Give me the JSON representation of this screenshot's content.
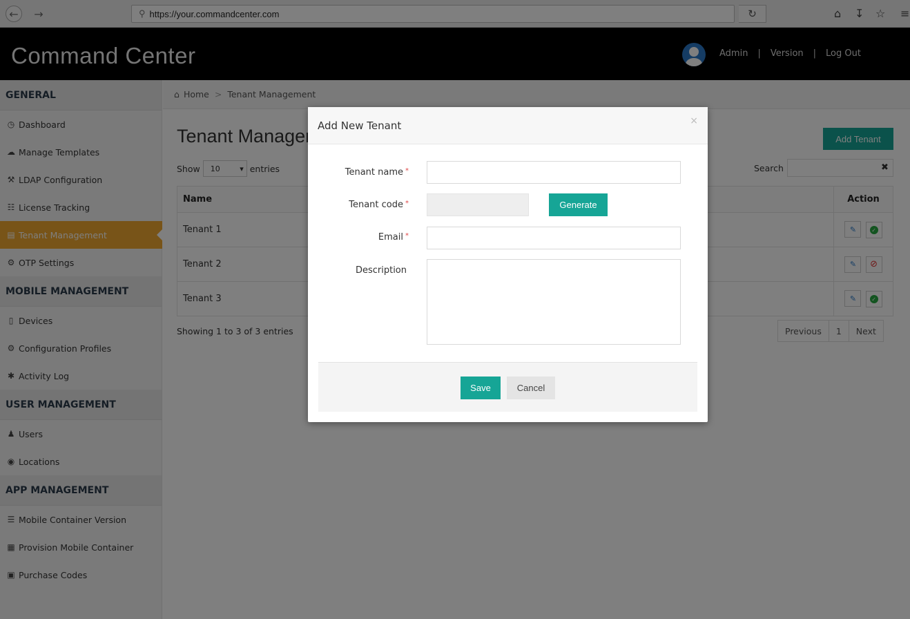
{
  "browser": {
    "url": "https://your.commandcenter.com",
    "back_icon": "back-arrow-icon",
    "forward_icon": "forward-arrow-icon"
  },
  "header": {
    "title": "Command Center",
    "user": "Admin",
    "sep": "|",
    "version": "Version",
    "logout": "Log Out"
  },
  "sidebar": {
    "general": {
      "heading": "GENERAL",
      "items": [
        {
          "label": "Dashboard",
          "icon": "dashboard-icon"
        },
        {
          "label": "Manage Templates",
          "icon": "cloud-icon"
        },
        {
          "label": "LDAP Configuration",
          "icon": "wrench-icon"
        },
        {
          "label": "License Tracking",
          "icon": "barcode-icon"
        },
        {
          "label": "Tenant Management",
          "icon": "list-icon"
        },
        {
          "label": "OTP Settings",
          "icon": "gear-icon"
        }
      ]
    },
    "mobile": {
      "heading": "MOBILE MANAGEMENT",
      "items": [
        {
          "label": "Devices",
          "icon": "mobile-icon"
        },
        {
          "label": "Configuration Profiles",
          "icon": "gear-icon"
        },
        {
          "label": "Activity Log",
          "icon": "asterisk-icon"
        }
      ]
    },
    "user": {
      "heading": "USER MANAGEMENT",
      "items": [
        {
          "label": "Users",
          "icon": "user-icon"
        },
        {
          "label": "Locations",
          "icon": "globe-icon"
        }
      ]
    },
    "app": {
      "heading": "APP MANAGEMENT",
      "items": [
        {
          "label": "Mobile Container Version",
          "icon": "list-icon"
        },
        {
          "label": "Provision Mobile Container",
          "icon": "qrcode-icon"
        },
        {
          "label": "Purchase Codes",
          "icon": "briefcase-icon"
        }
      ]
    }
  },
  "breadcrumb": {
    "home": "Home",
    "sep": ">",
    "current": "Tenant Management"
  },
  "page": {
    "title": "Tenant Management",
    "add_button": "Add Tenant",
    "show": "Show",
    "entries_value": "10",
    "entries": "entries",
    "search_label": "Search",
    "clear_icon": "close-icon",
    "columns": {
      "name": "Name",
      "action": "Action"
    },
    "rows": [
      {
        "name": "Tenant 1",
        "status": "active"
      },
      {
        "name": "Tenant 2",
        "status": "inactive"
      },
      {
        "name": "Tenant 3",
        "status": "active"
      }
    ],
    "showing": "Showing 1 to 3 of 3 entries",
    "pager": {
      "previous": "Previous",
      "page": "1",
      "next": "Next"
    }
  },
  "modal": {
    "title": "Add New Tenant",
    "close": "×",
    "fields": {
      "tenant_name": "Tenant name",
      "tenant_code": "Tenant code",
      "email": "Email",
      "description": "Description",
      "required_mark": "*"
    },
    "generate": "Generate",
    "save": "Save",
    "cancel": "Cancel"
  },
  "colors": {
    "accent": "#16a596",
    "active_nav": "#f0a830",
    "header_bg": "#000000"
  }
}
